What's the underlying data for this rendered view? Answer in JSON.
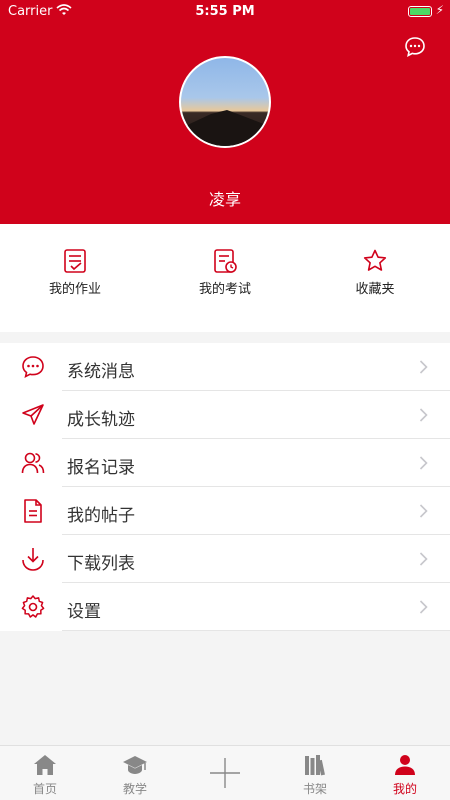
{
  "status": {
    "carrier": "Carrier",
    "time": "5:55 PM"
  },
  "profile": {
    "username": "凌享"
  },
  "quick": [
    {
      "label": "我的作业",
      "icon": "homework-icon"
    },
    {
      "label": "我的考试",
      "icon": "exam-icon"
    },
    {
      "label": "收藏夹",
      "icon": "star-icon"
    }
  ],
  "menu": [
    {
      "label": "系统消息",
      "icon": "message-icon"
    },
    {
      "label": "成长轨迹",
      "icon": "send-icon"
    },
    {
      "label": "报名记录",
      "icon": "users-icon"
    },
    {
      "label": "我的帖子",
      "icon": "document-icon"
    },
    {
      "label": "下载列表",
      "icon": "download-icon"
    },
    {
      "label": "设置",
      "icon": "settings-icon"
    }
  ],
  "tabs": [
    {
      "label": "首页",
      "icon": "home-icon"
    },
    {
      "label": "教学",
      "icon": "graduation-cap-icon"
    },
    {
      "label": "",
      "icon": "plus-icon"
    },
    {
      "label": "书架",
      "icon": "bookshelf-icon"
    },
    {
      "label": "我的",
      "icon": "person-icon",
      "active": true
    }
  ],
  "colors": {
    "brand": "#d0021b",
    "battery": "#4cd964"
  }
}
